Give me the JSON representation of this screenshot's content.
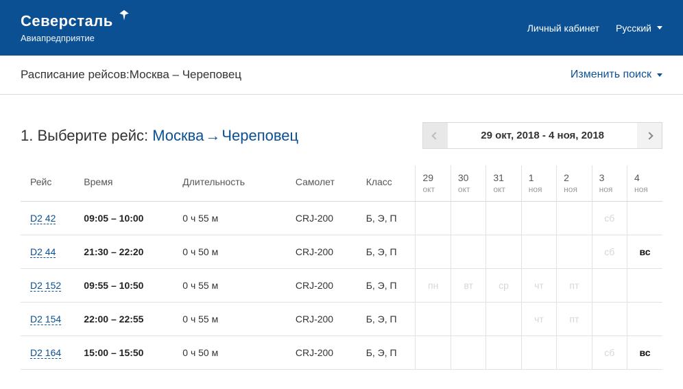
{
  "header": {
    "logo_text": "Северсталь",
    "logo_sub": "Авиапредприятие",
    "account_link": "Личный кабинет",
    "language": "Русский"
  },
  "subheader": {
    "breadcrumb": "Расписание рейсов:Москва – Череповец",
    "change_search": "Изменить поиск"
  },
  "step": {
    "prefix": "1. Выберите рейс: ",
    "from": "Москва",
    "to": "Череповец",
    "date_range": "29 окт, 2018 - 4 ноя, 2018"
  },
  "table": {
    "headers": {
      "flight": "Рейс",
      "time": "Время",
      "duration": "Длительность",
      "aircraft": "Самолет",
      "class": "Класс"
    },
    "days": [
      {
        "num": "29",
        "mon": "окт"
      },
      {
        "num": "30",
        "mon": "окт"
      },
      {
        "num": "31",
        "mon": "окт"
      },
      {
        "num": "1",
        "mon": "ноя"
      },
      {
        "num": "2",
        "mon": "ноя"
      },
      {
        "num": "3",
        "mon": "ноя"
      },
      {
        "num": "4",
        "mon": "ноя"
      }
    ],
    "rows": [
      {
        "flight": "D2 42",
        "time": "09:05 – 10:00",
        "duration": "0 ч 55 м",
        "aircraft": "CRJ-200",
        "class": "Б, Э, П",
        "cells": [
          "",
          "",
          "",
          "",
          "",
          {
            "text": "сб",
            "muted": true
          },
          ""
        ]
      },
      {
        "flight": "D2 44",
        "time": "21:30 – 22:20",
        "duration": "0 ч 50 м",
        "aircraft": "CRJ-200",
        "class": "Б, Э, П",
        "cells": [
          "",
          "",
          "",
          "",
          "",
          {
            "text": "сб",
            "muted": true
          },
          {
            "text": "вс",
            "active": true
          }
        ]
      },
      {
        "flight": "D2 152",
        "time": "09:55 – 10:50",
        "duration": "0 ч 55 м",
        "aircraft": "CRJ-200",
        "class": "Б, Э, П",
        "cells": [
          {
            "text": "пн",
            "muted": true
          },
          {
            "text": "вт",
            "muted": true
          },
          {
            "text": "ср",
            "muted": true
          },
          {
            "text": "чт",
            "muted": true
          },
          {
            "text": "пт",
            "muted": true
          },
          "",
          ""
        ]
      },
      {
        "flight": "D2 154",
        "time": "22:00 – 22:55",
        "duration": "0 ч 55 м",
        "aircraft": "CRJ-200",
        "class": "Б, Э, П",
        "cells": [
          "",
          "",
          "",
          {
            "text": "чт",
            "muted": true
          },
          {
            "text": "пт",
            "muted": true
          },
          "",
          ""
        ]
      },
      {
        "flight": "D2 164",
        "time": "15:00 – 15:50",
        "duration": "0 ч 50 м",
        "aircraft": "CRJ-200",
        "class": "Б, Э, П",
        "cells": [
          "",
          "",
          "",
          "",
          "",
          {
            "text": "сб",
            "muted": true
          },
          {
            "text": "вс",
            "active": true
          }
        ]
      }
    ]
  }
}
